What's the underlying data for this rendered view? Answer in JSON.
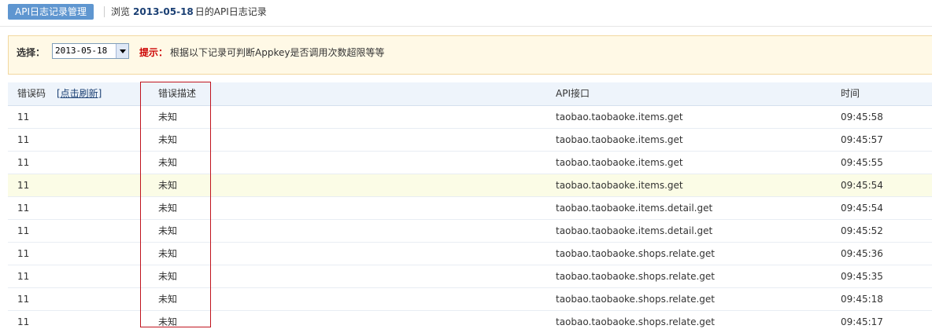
{
  "header": {
    "tab_label": "API日志记录管理",
    "browse_prefix": "浏览",
    "browse_date": "2013-05-18",
    "browse_suffix": "日的API日志记录"
  },
  "filter": {
    "label": "选择：",
    "selected_date": "2013-05-18",
    "tip_label": "提示：",
    "tip_text": "根据以下记录可判断Appkey是否调用次数超限等等"
  },
  "table": {
    "columns": {
      "code": "错误码",
      "refresh_link": "[点击刷新]",
      "desc": "错误描述",
      "api": "API接口",
      "time": "时间"
    },
    "rows": [
      {
        "code": "11",
        "desc": "未知",
        "api": "taobao.taobaoke.items.get",
        "time": "09:45:58"
      },
      {
        "code": "11",
        "desc": "未知",
        "api": "taobao.taobaoke.items.get",
        "time": "09:45:57"
      },
      {
        "code": "11",
        "desc": "未知",
        "api": "taobao.taobaoke.items.get",
        "time": "09:45:55"
      },
      {
        "code": "11",
        "desc": "未知",
        "api": "taobao.taobaoke.items.get",
        "time": "09:45:54"
      },
      {
        "code": "11",
        "desc": "未知",
        "api": "taobao.taobaoke.items.detail.get",
        "time": "09:45:54"
      },
      {
        "code": "11",
        "desc": "未知",
        "api": "taobao.taobaoke.items.detail.get",
        "time": "09:45:52"
      },
      {
        "code": "11",
        "desc": "未知",
        "api": "taobao.taobaoke.shops.relate.get",
        "time": "09:45:36"
      },
      {
        "code": "11",
        "desc": "未知",
        "api": "taobao.taobaoke.shops.relate.get",
        "time": "09:45:35"
      },
      {
        "code": "11",
        "desc": "未知",
        "api": "taobao.taobaoke.shops.relate.get",
        "time": "09:45:18"
      },
      {
        "code": "11",
        "desc": "未知",
        "api": "taobao.taobaoke.shops.relate.get",
        "time": "09:45:17"
      }
    ]
  },
  "colors": {
    "tab_active": "#5f96d0",
    "tip_red": "#cc0000",
    "annotation_box": "#c0141e",
    "highlighted_row": "#fbfce6"
  }
}
